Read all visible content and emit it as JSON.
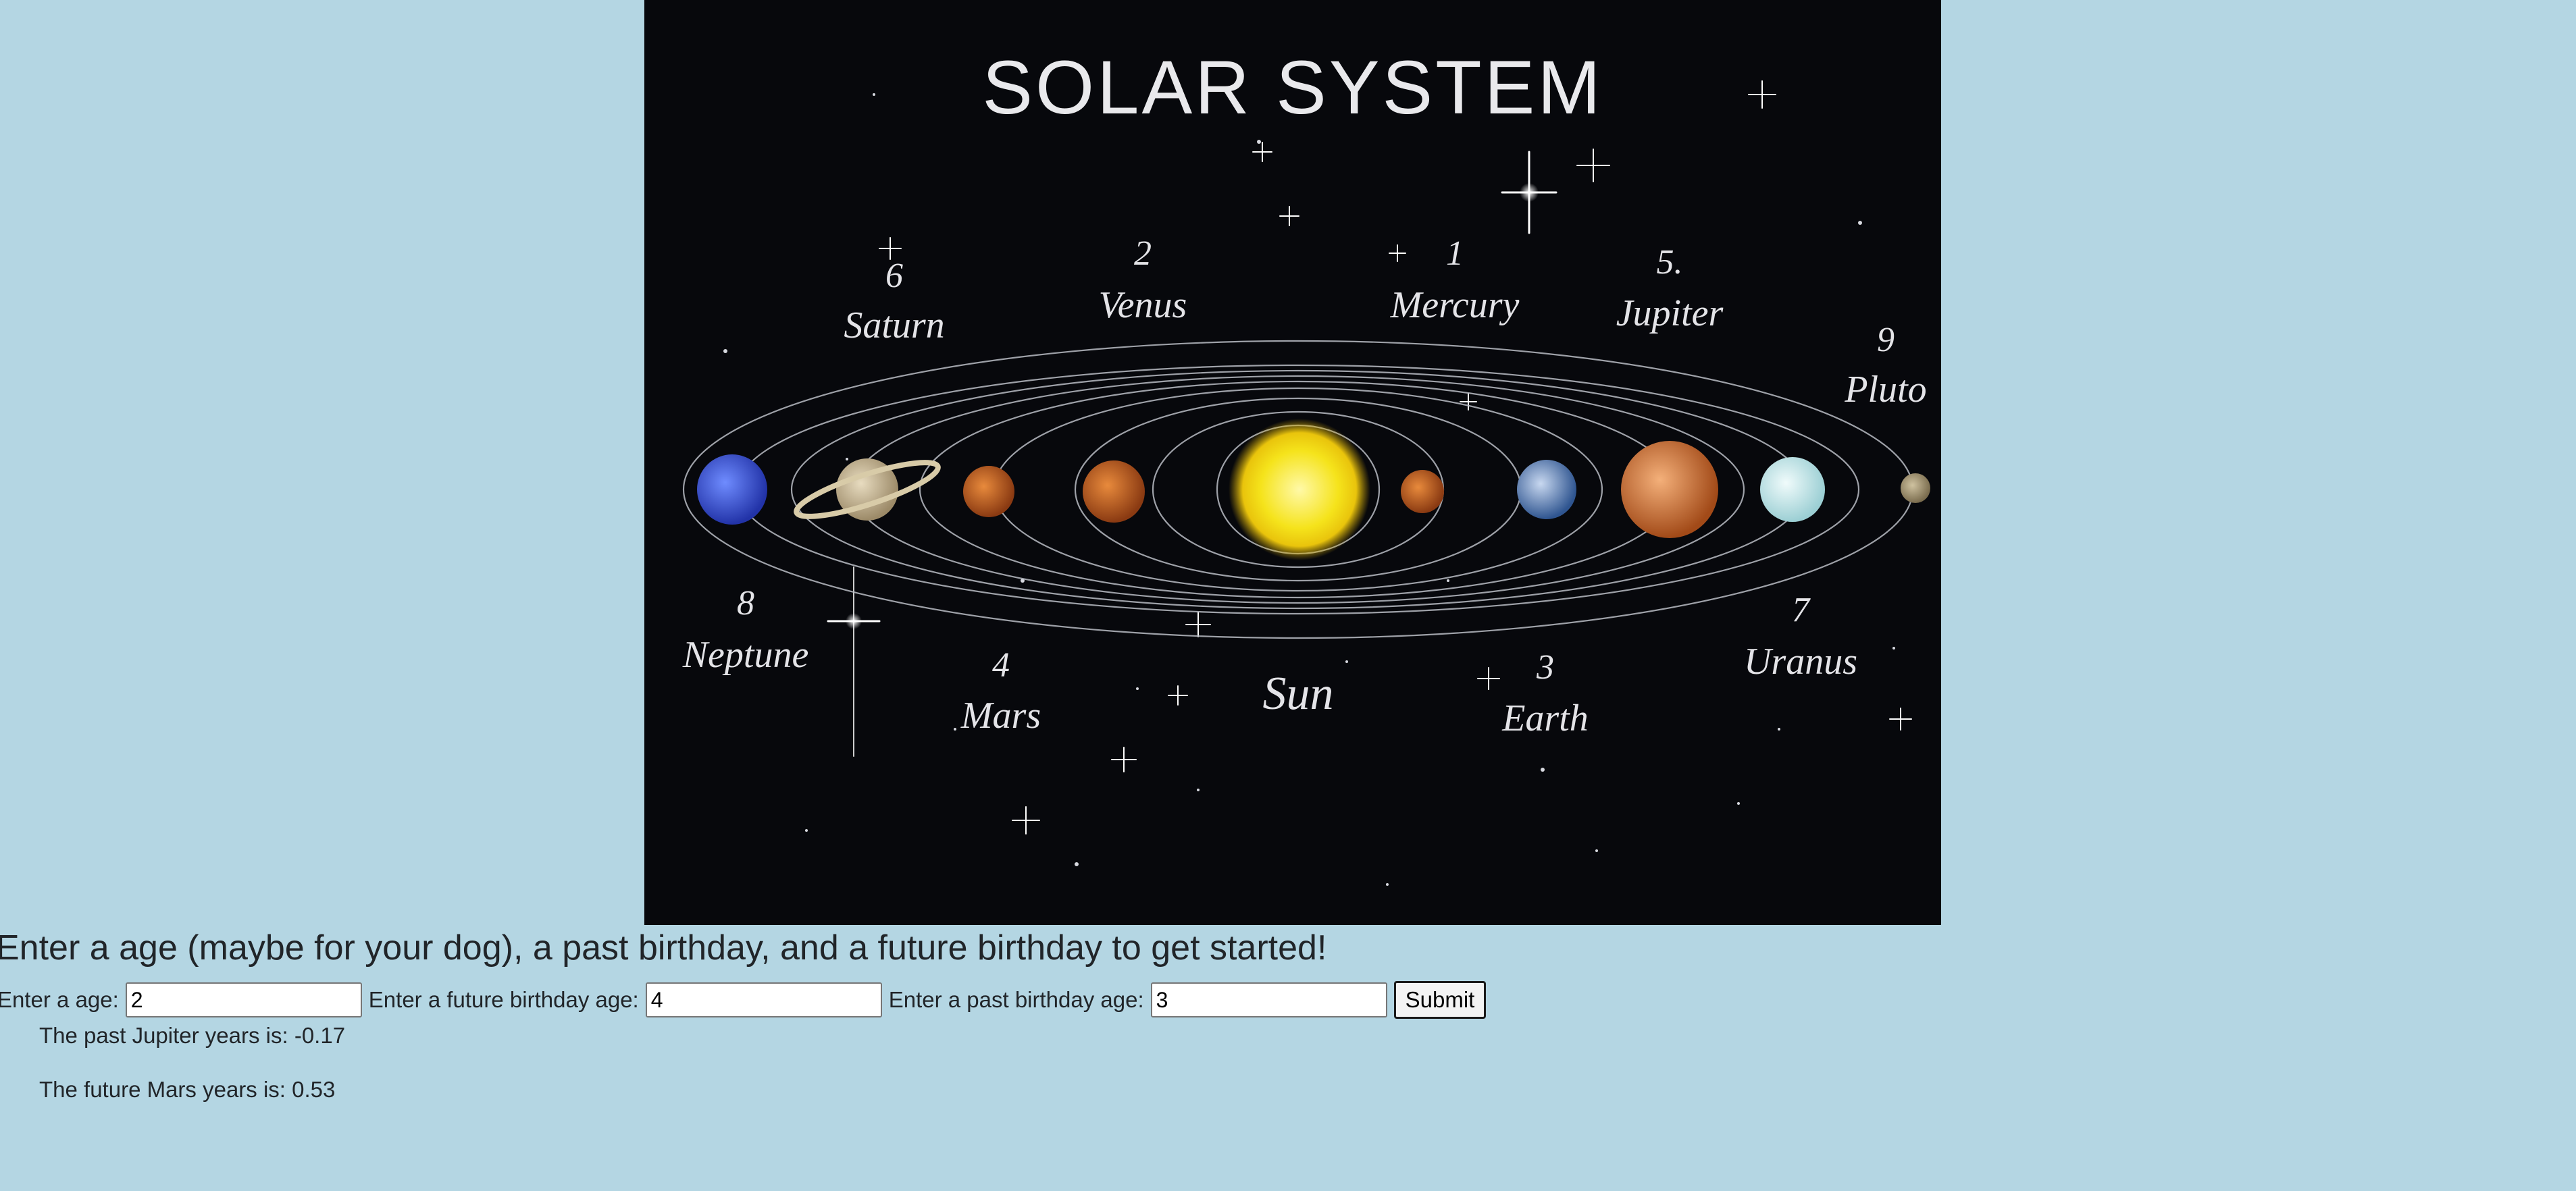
{
  "image": {
    "title": "SOLAR SYSTEM",
    "planets": [
      {
        "number": "1",
        "name": "Mercury"
      },
      {
        "number": "2",
        "name": "Venus"
      },
      {
        "number": "3",
        "name": "Earth"
      },
      {
        "number": "4",
        "name": "Mars"
      },
      {
        "number": "5.",
        "name": "Jupiter"
      },
      {
        "number": "6",
        "name": "Saturn"
      },
      {
        "number": "7",
        "name": "Uranus"
      },
      {
        "number": "8",
        "name": "Neptune"
      },
      {
        "number": "9",
        "name": "Pluto"
      }
    ],
    "sun_label": "Sun"
  },
  "heading": "Enter a age (maybe for your dog), a past birthday, and a future birthday to get started!",
  "form": {
    "age_label": "Enter a age:",
    "age_value": "2",
    "future_label": "Enter a future birthday age:",
    "future_value": "4",
    "past_label": "Enter a past birthday age:",
    "past_value": "3",
    "submit_label": "Submit"
  },
  "results": {
    "past": "The past Jupiter years is: -0.17",
    "future": "The future Mars years is: 0.53"
  },
  "colors": {
    "page_background": "#b4d6e3",
    "image_background": "#07080c"
  }
}
